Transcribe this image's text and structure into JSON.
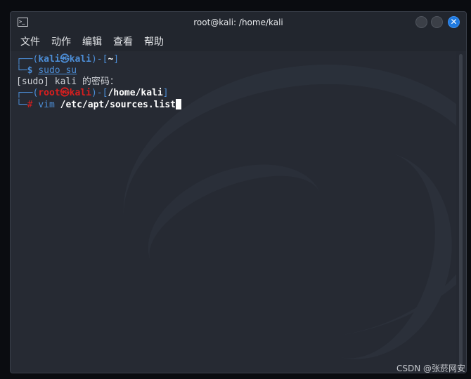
{
  "window": {
    "title": "root@kali: /home/kali",
    "close_glyph": "✕"
  },
  "menu": [
    "文件",
    "动作",
    "编辑",
    "查看",
    "帮助"
  ],
  "terminal": {
    "line1": {
      "open": "┌──(",
      "user": "kali",
      "at": "㉿",
      "host": "kali",
      "sep": ")-[",
      "path": "~",
      "close": "]"
    },
    "line2": {
      "prefix": "└─",
      "prompt": "$",
      "command": "sudo su"
    },
    "line3": {
      "text": "[sudo] kali 的密码："
    },
    "line4": {
      "open": "┌──(",
      "user": "root",
      "at": "㉿",
      "host": "kali",
      "sep": ")-[",
      "path": "/home/kali",
      "close": "]"
    },
    "line5": {
      "prefix": "└─",
      "prompt": "#",
      "cmd": "vim",
      "arg": "/etc/apt/sources.list"
    }
  },
  "icons": {
    "terminal": "terminal-icon",
    "minimize": "minimize-icon",
    "maximize": "maximize-icon",
    "close": "close-icon"
  },
  "colors": {
    "prompt_blue": "#4c8dd6",
    "root_red": "#d91e1e",
    "close_button": "#1f7ae0",
    "terminal_bg": "#262a33"
  },
  "watermark": "CSDN @张菸网安"
}
